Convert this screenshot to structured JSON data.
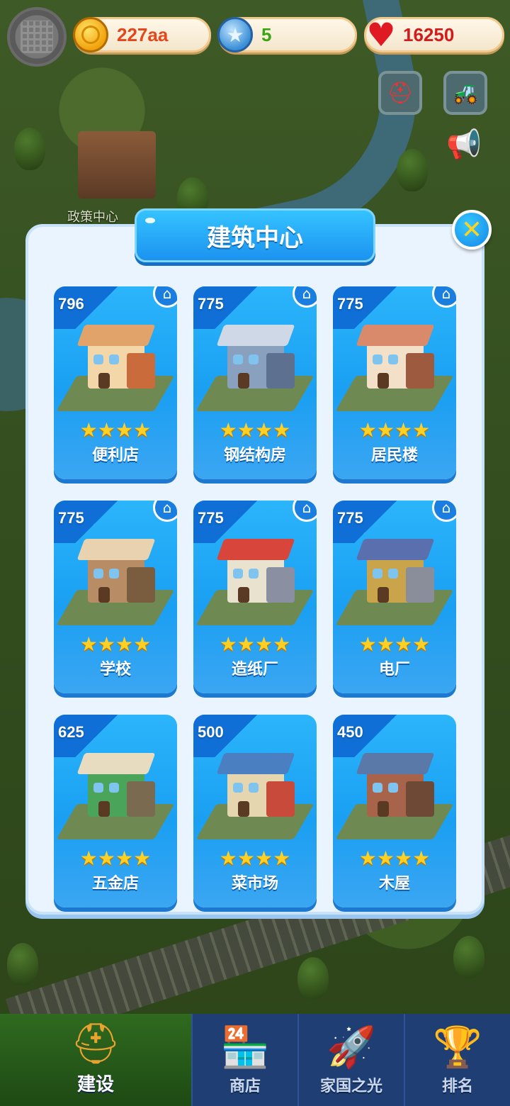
{
  "map": {
    "building_label": "政策中心"
  },
  "resources": {
    "coins": "227aa",
    "stars": "5",
    "hearts": "16250"
  },
  "icons": {
    "coin": "coin-icon",
    "star": "star-icon",
    "heart": "heart-icon",
    "side_top_left": "robot-icon",
    "side_top_right": "tractor-icon",
    "speaker": "speaker-icon",
    "close": "close-icon",
    "home": "home-icon"
  },
  "modal": {
    "title": "建筑中心",
    "cards": [
      {
        "number": "796",
        "name": "便利店",
        "stars": "★★★★",
        "has_home": true
      },
      {
        "number": "775",
        "name": "钢结构房",
        "stars": "★★★★",
        "has_home": true
      },
      {
        "number": "775",
        "name": "居民楼",
        "stars": "★★★★",
        "has_home": true
      },
      {
        "number": "775",
        "name": "学校",
        "stars": "★★★★",
        "has_home": true
      },
      {
        "number": "775",
        "name": "造纸厂",
        "stars": "★★★★",
        "has_home": true
      },
      {
        "number": "775",
        "name": "电厂",
        "stars": "★★★★",
        "has_home": true
      },
      {
        "number": "625",
        "name": "五金店",
        "stars": "★★★★",
        "has_home": false
      },
      {
        "number": "500",
        "name": "菜市场",
        "stars": "★★★★",
        "has_home": false
      },
      {
        "number": "450",
        "name": "木屋",
        "stars": "★★★★",
        "has_home": false
      }
    ]
  },
  "nav": {
    "items": [
      {
        "label": "建设",
        "active": true
      },
      {
        "label": "商店",
        "active": false
      },
      {
        "label": "家国之光",
        "active": false
      },
      {
        "label": "排名",
        "active": false
      }
    ]
  },
  "colors": {
    "accent": "#1a9ff2",
    "coin_text": "#e2481c",
    "star_text": "#3aa514",
    "heart_text": "#d21b1b",
    "gold_star": "#ffd024"
  }
}
